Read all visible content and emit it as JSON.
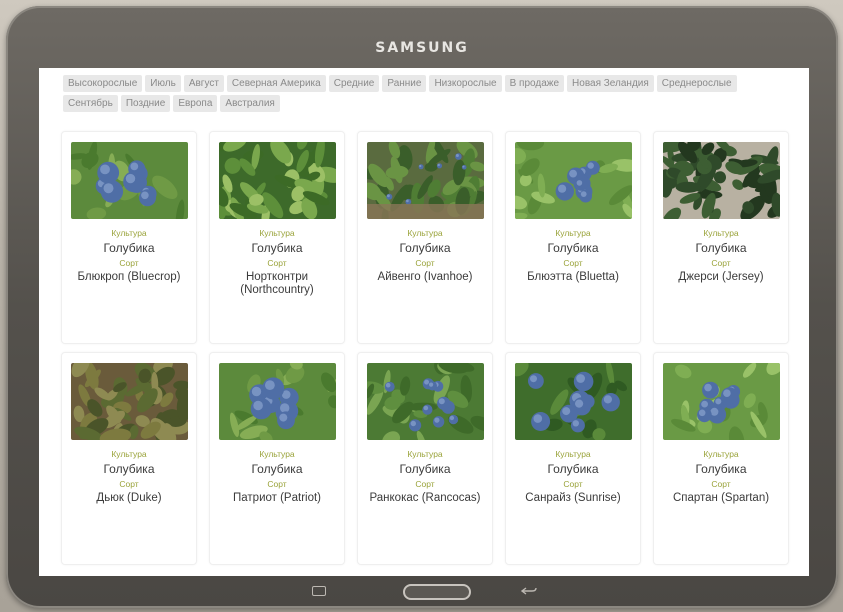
{
  "device": {
    "brand": "SAMSUNG"
  },
  "filters": [
    "Высокорослые",
    "Июль",
    "Август",
    "Северная Америка",
    "Средние",
    "Ранние",
    "Низкорослые",
    "В продаже",
    "Новая Зеландия",
    "Среднерослые",
    "Сентябрь",
    "Поздние",
    "Европа",
    "Австралия"
  ],
  "labels": {
    "crop": "Культура",
    "variety": "Сорт"
  },
  "cards": [
    {
      "crop": "Голубика",
      "variety": "Блюкроп (Bluecrop)",
      "photo": "berries-closeup"
    },
    {
      "crop": "Голубика",
      "variety": "Нортконтри (Northcountry)",
      "photo": "bush-green"
    },
    {
      "crop": "Голубика",
      "variety": "Айвенго (Ivanhoe)",
      "photo": "bush-field"
    },
    {
      "crop": "Голубика",
      "variety": "Блюэтта (Bluetta)",
      "photo": "berries-cluster"
    },
    {
      "crop": "Голубика",
      "variety": "Джерси (Jersey)",
      "photo": "bush-dark"
    },
    {
      "crop": "Голубика",
      "variety": "Дьюк (Duke)",
      "photo": "bush-dry"
    },
    {
      "crop": "Голубика",
      "variety": "Патриот (Patriot)",
      "photo": "berries-closeup"
    },
    {
      "crop": "Голубика",
      "variety": "Ранкокас (Rancocas)",
      "photo": "berries-branch"
    },
    {
      "crop": "Голубика",
      "variety": "Санрайз (Sunrise)",
      "photo": "berries-large"
    },
    {
      "crop": "Голубика",
      "variety": "Спартан (Spartan)",
      "photo": "berries-cluster"
    }
  ],
  "colors": {
    "label_accent": "#9aa33a",
    "tag_bg": "#e8e8e8",
    "berry": "#4f6ea6"
  }
}
